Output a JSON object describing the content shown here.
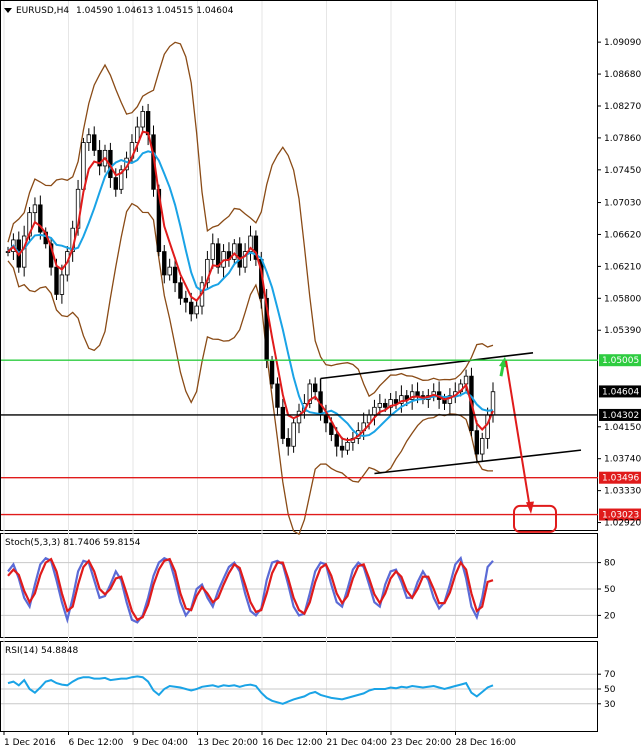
{
  "header": {
    "symbol": "EURUSD,H4",
    "ohlc": "1.04590 1.04613 1.04515 1.04604"
  },
  "indicators": {
    "stoch_label": "Stoch(5,3,3) 81.7406 59.8154",
    "rsi_label": "RSI(14) 54.8848"
  },
  "colors": {
    "up_down_candles": "#000000",
    "sma": "#1aa3e6",
    "ema": "#e01b1b",
    "bollinger": "#8a4b16",
    "support_red": "#e01b1b",
    "resistance_green": "#2ecc40",
    "level_black": "#000000",
    "stoch_main": "#5b6bd6",
    "stoch_signal": "#e01b1b",
    "rsi": "#1aa3e6"
  },
  "chart_data": [
    {
      "type": "candlestick",
      "symbol": "EURUSD",
      "timeframe": "H4",
      "y_ticks": [
        "1.09090",
        "1.08680",
        "1.08270",
        "1.07860",
        "1.07450",
        "1.07030",
        "1.06620",
        "1.06210",
        "1.05800",
        "1.05390",
        "1.04150",
        "1.03740",
        "1.03330",
        "1.02920"
      ],
      "ylim": [
        1.0285,
        1.094
      ],
      "x_ticks": [
        "1 Dec 2016",
        "6 Dec 12:00",
        "9 Dec 04:00",
        "13 Dec 20:00",
        "16 Dec 12:00",
        "21 Dec 04:00",
        "23 Dec 20:00",
        "28 Dec 16:00"
      ],
      "current_price": {
        "value": 1.04604,
        "label": "1.04604"
      },
      "horizontal_levels": [
        {
          "label": "1.05005",
          "value": 1.05005,
          "color": "#2ecc40"
        },
        {
          "label": "1.04302",
          "value": 1.04302,
          "color": "#000000"
        },
        {
          "label": "1.03496",
          "value": 1.03496,
          "color": "#e01b1b"
        },
        {
          "label": "1.03023",
          "value": 1.03023,
          "color": "#e01b1b"
        }
      ],
      "closes": [
        1.064,
        1.0655,
        1.062,
        1.066,
        1.069,
        1.07,
        1.0665,
        1.065,
        1.062,
        1.0585,
        1.061,
        1.064,
        1.067,
        1.072,
        1.078,
        1.079,
        1.077,
        1.075,
        1.077,
        1.0735,
        1.072,
        1.0745,
        1.076,
        1.078,
        1.08,
        1.082,
        1.079,
        1.072,
        1.064,
        1.061,
        1.062,
        1.06,
        1.058,
        1.0575,
        1.056,
        1.057,
        1.06,
        1.063,
        1.065,
        1.062,
        1.064,
        1.063,
        1.065,
        1.062,
        1.064,
        1.066,
        1.063,
        1.058,
        1.05,
        1.047,
        1.044,
        1.04,
        1.039,
        1.042,
        1.0435,
        1.0445,
        1.047,
        1.046,
        1.043,
        1.042,
        1.0405,
        1.039,
        1.0385,
        1.0395,
        1.04,
        1.041,
        1.042,
        1.043,
        1.044,
        1.0445,
        1.044,
        1.045,
        1.0445,
        1.0455,
        1.045,
        1.046,
        1.0455,
        1.045,
        1.0455,
        1.046,
        1.045,
        1.0445,
        1.0455,
        1.046,
        1.047,
        1.048,
        1.041,
        1.038,
        1.04,
        1.043,
        1.046
      ]
    },
    {
      "type": "line",
      "name": "Stoch(5,3,3)",
      "y_ticks": [
        "80",
        "50",
        "20"
      ],
      "ylim": [
        0,
        100
      ],
      "main": [
        70,
        78,
        62,
        40,
        30,
        55,
        78,
        85,
        82,
        60,
        35,
        15,
        40,
        70,
        82,
        80,
        60,
        40,
        42,
        55,
        70,
        60,
        35,
        15,
        12,
        20,
        40,
        65,
        80,
        85,
        82,
        60,
        35,
        20,
        28,
        50,
        55,
        40,
        30,
        48,
        62,
        75,
        80,
        70,
        45,
        25,
        20,
        28,
        60,
        80,
        82,
        78,
        55,
        30,
        20,
        22,
        45,
        70,
        80,
        78,
        55,
        35,
        30,
        50,
        72,
        80,
        75,
        55,
        35,
        30,
        55,
        70,
        72,
        58,
        40,
        40,
        58,
        70,
        60,
        40,
        28,
        35,
        55,
        78,
        85,
        62,
        30,
        18,
        40,
        75,
        82
      ],
      "signal": [
        65,
        72,
        66,
        48,
        35,
        45,
        66,
        80,
        84,
        70,
        45,
        25,
        30,
        55,
        75,
        82,
        70,
        50,
        44,
        50,
        62,
        64,
        45,
        25,
        15,
        18,
        32,
        55,
        72,
        82,
        84,
        70,
        45,
        28,
        26,
        42,
        52,
        45,
        35,
        40,
        55,
        68,
        78,
        74,
        55,
        35,
        24,
        26,
        45,
        68,
        80,
        80,
        62,
        40,
        26,
        22,
        35,
        58,
        74,
        78,
        65,
        45,
        34,
        42,
        62,
        76,
        78,
        62,
        44,
        34,
        45,
        62,
        70,
        64,
        48,
        40,
        50,
        64,
        64,
        50,
        34,
        34,
        46,
        66,
        80,
        72,
        45,
        25,
        30,
        58,
        60
      ]
    },
    {
      "type": "line",
      "name": "RSI(14)",
      "y_ticks": [
        "70",
        "50",
        "30"
      ],
      "ylim": [
        0,
        100
      ],
      "values": [
        58,
        60,
        55,
        62,
        50,
        45,
        52,
        60,
        62,
        58,
        56,
        55,
        60,
        64,
        66,
        66,
        64,
        64,
        65,
        62,
        63,
        64,
        64,
        66,
        67,
        66,
        60,
        48,
        42,
        50,
        54,
        53,
        52,
        50,
        48,
        50,
        53,
        54,
        55,
        53,
        55,
        54,
        55,
        53,
        55,
        56,
        54,
        45,
        38,
        34,
        32,
        30,
        33,
        36,
        38,
        40,
        44,
        46,
        42,
        40,
        38,
        37,
        36,
        38,
        40,
        42,
        44,
        48,
        50,
        50,
        50,
        52,
        51,
        53,
        52,
        54,
        53,
        52,
        53,
        54,
        52,
        50,
        52,
        54,
        56,
        58,
        45,
        40,
        46,
        52,
        55
      ]
    }
  ]
}
